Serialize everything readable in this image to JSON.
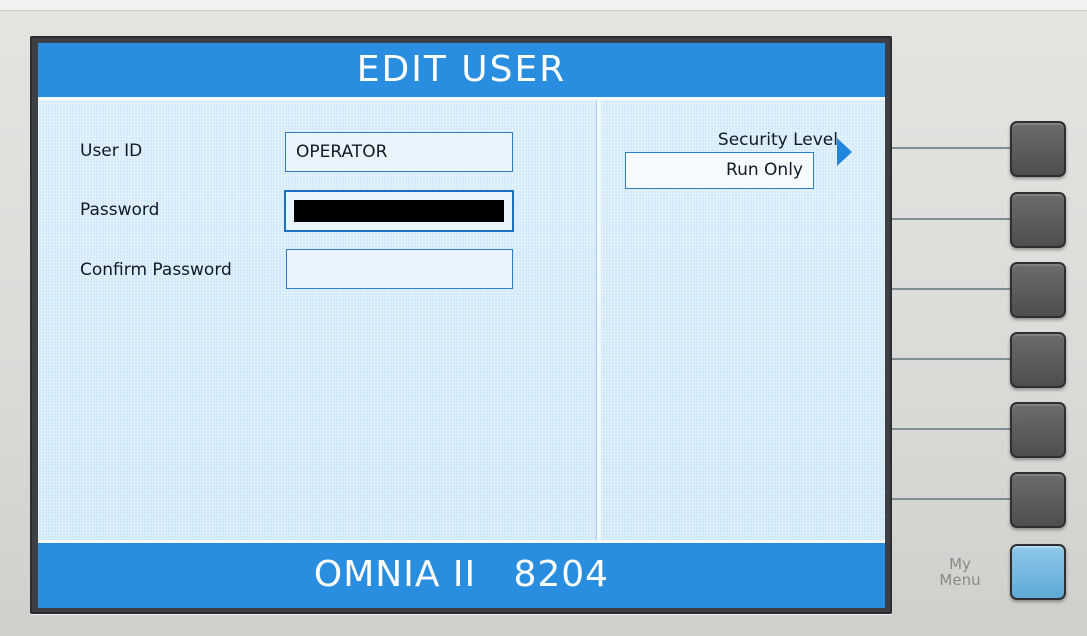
{
  "screen": {
    "title": "EDIT USER",
    "footer": "OMNIA II   8204"
  },
  "form": {
    "user_id_label": "User ID",
    "user_id_value": "OPERATOR",
    "password_label": "Password",
    "confirm_password_label": "Confirm Password",
    "confirm_password_value": ""
  },
  "side_panel": {
    "security_level_label": "Security Level",
    "security_level_value": "Run Only",
    "selector_icon": "triangle-right-icon"
  },
  "hardware": {
    "my_menu_label_line1": "My",
    "my_menu_label_line2": "Menu"
  },
  "colors": {
    "header_blue": "#2a8ee0",
    "lcd_background": "#d5ebfa",
    "field_border": "#2d7ec6",
    "my_menu_key": "#7bbde3"
  }
}
